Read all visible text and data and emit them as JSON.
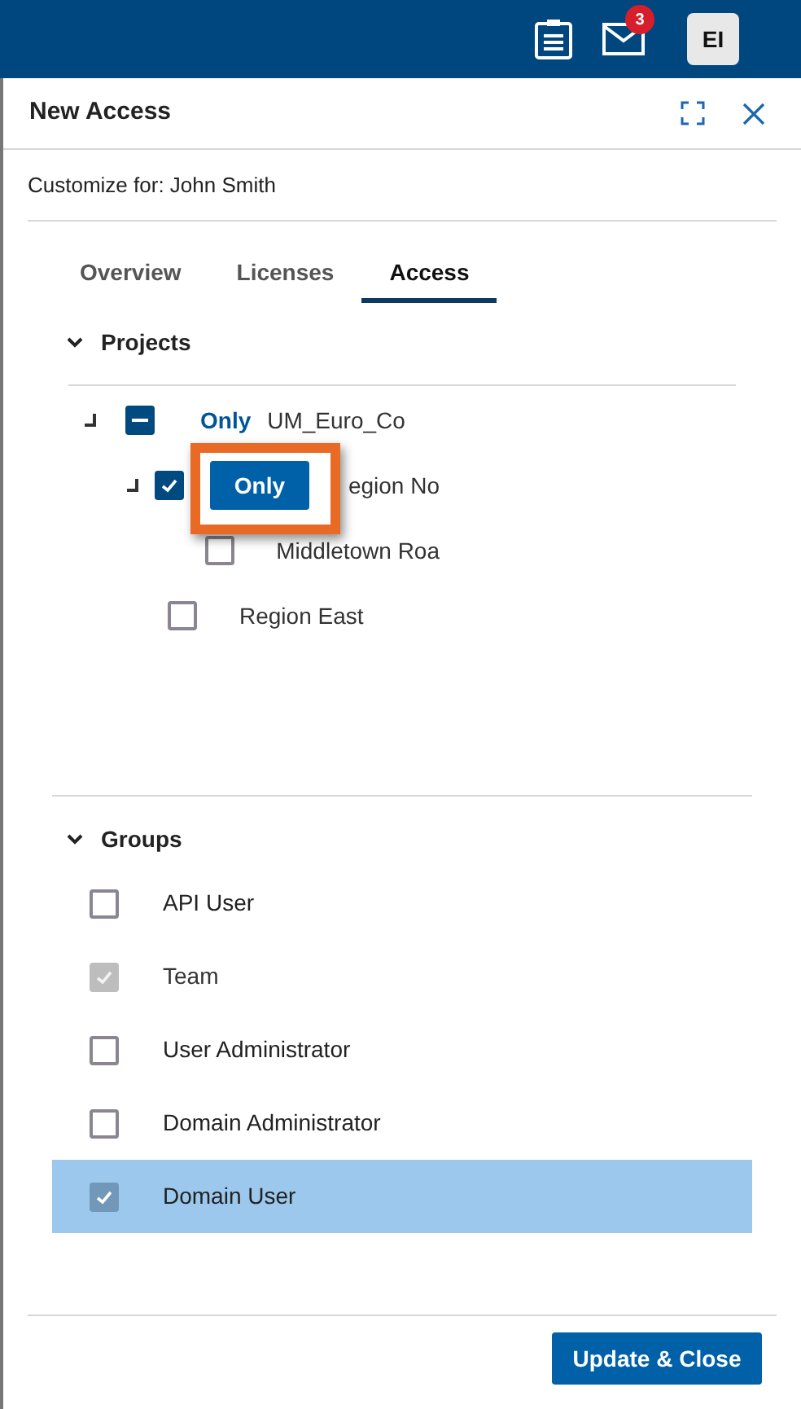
{
  "top_bar": {
    "notifications_badge": "3",
    "avatar": "EI"
  },
  "panel": {
    "title": "New Access",
    "subtitle": "Customize for: John Smith"
  },
  "tabs": [
    {
      "label": "Overview",
      "selected": false
    },
    {
      "label": "Licenses",
      "selected": false
    },
    {
      "label": "Access",
      "selected": true
    }
  ],
  "projects": {
    "title": "Projects",
    "expanded": true,
    "tree": [
      {
        "label": "UM_Euro_Co",
        "checked": true,
        "partial": true,
        "only": {
          "kind": "link",
          "label": "Only"
        },
        "expanded": true,
        "children": [
          {
            "label": "egion No",
            "checked": true,
            "partial": false,
            "only": {
              "kind": "button",
              "label": "Only"
            },
            "highlighted": true,
            "expanded": true,
            "children": [
              {
                "label": "Middletown Roa",
                "checked": false,
                "partial": false
              }
            ]
          },
          {
            "label": "Region East",
            "checked": false,
            "partial": false
          }
        ]
      }
    ]
  },
  "groups": {
    "title": "Groups",
    "expanded": true,
    "items": [
      {
        "label": "API User",
        "checked": false,
        "disabled": false,
        "selected": false
      },
      {
        "label": "Team",
        "checked": true,
        "disabled": true,
        "selected": false
      },
      {
        "label": "User Administrator",
        "checked": false,
        "disabled": false,
        "selected": false
      },
      {
        "label": "Domain Administrator",
        "checked": false,
        "disabled": false,
        "selected": false
      },
      {
        "label": "Domain User",
        "checked": true,
        "disabled": false,
        "selected": true
      }
    ]
  },
  "footer": {
    "button": "Update & Close"
  }
}
